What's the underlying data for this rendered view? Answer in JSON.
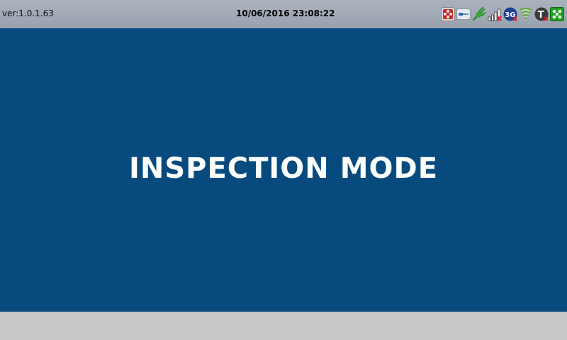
{
  "status_bar": {
    "version": "ver:1.0.1.63",
    "datetime": "10/06/2016 23:08:22",
    "icons": [
      "red-tools-icon",
      "card-reader-icon",
      "plug-connected-icon",
      "signal-bars-disconnected-icon",
      "3g-icon",
      "wifi-signal-icon",
      "t-disconnected-icon",
      "green-network-icon"
    ],
    "icon_3g_label": "3G",
    "icon_t_label": "T"
  },
  "main": {
    "title": "INSPECTION MODE"
  },
  "colors": {
    "status_bar": "#a0a8b3",
    "main_panel": "#064a7e",
    "footer": "#c8c8c8",
    "title_text": "#ffffff"
  }
}
